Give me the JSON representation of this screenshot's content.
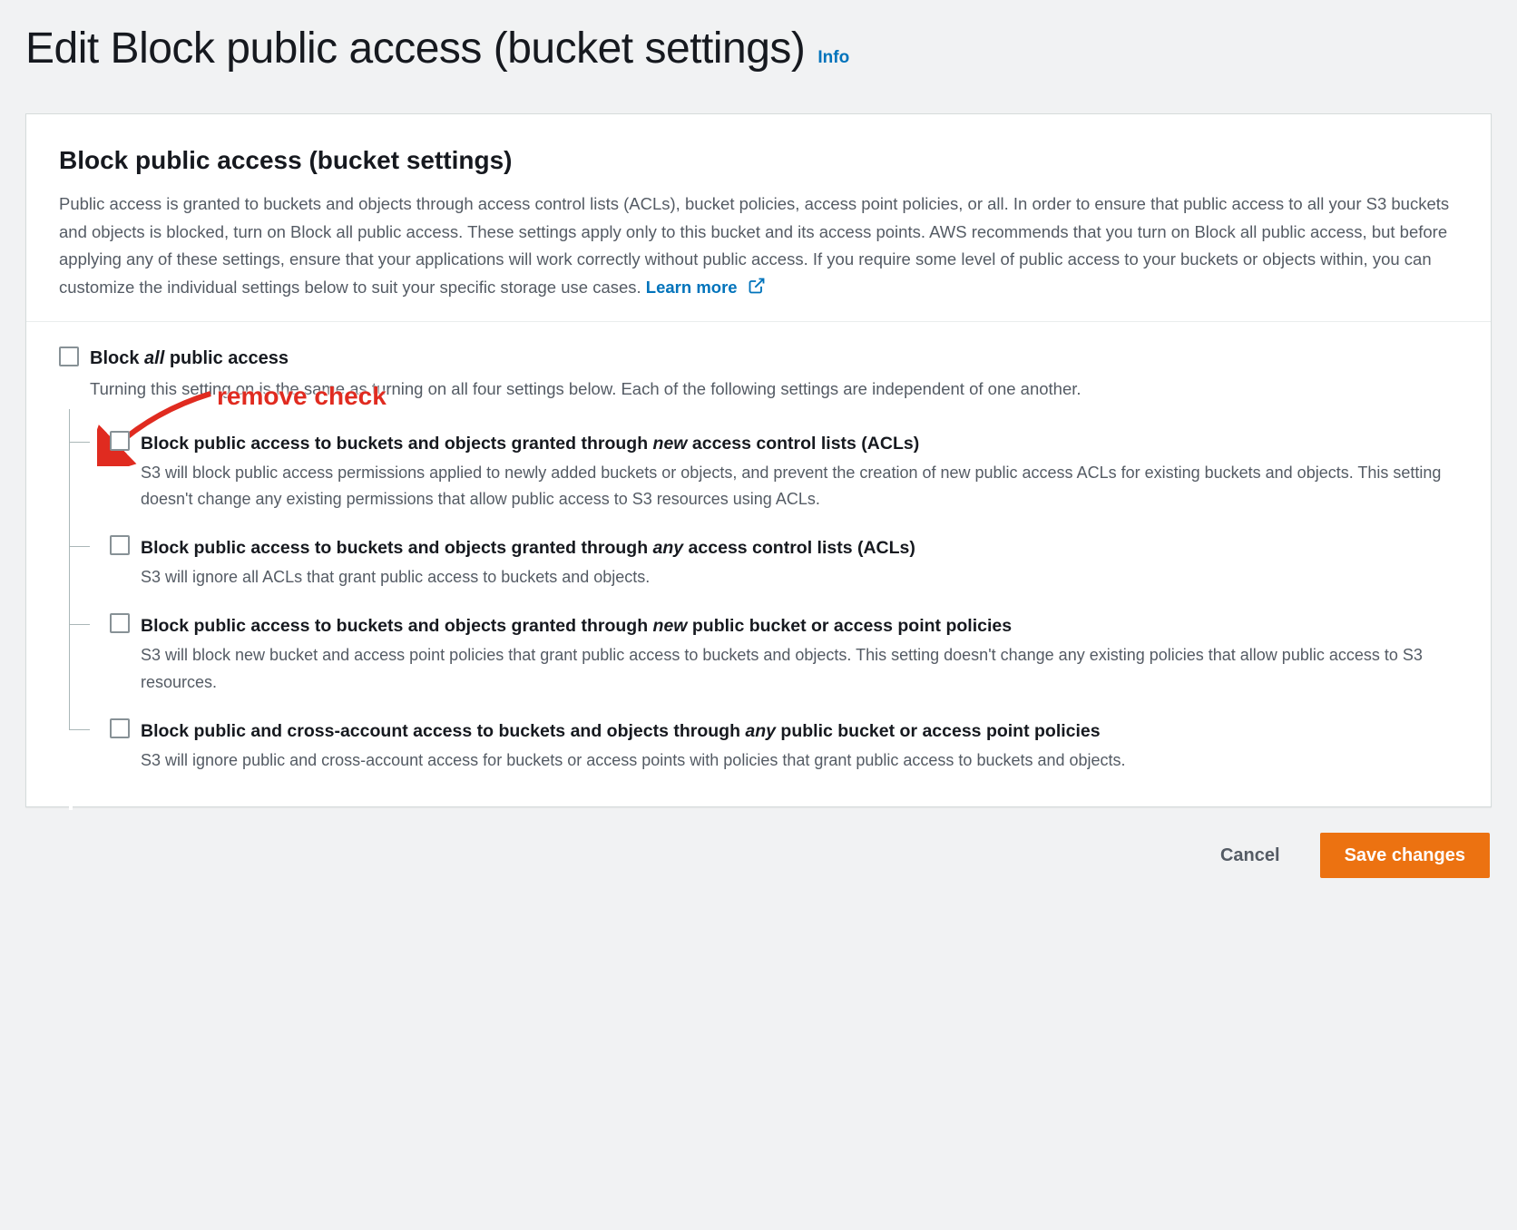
{
  "page": {
    "title": "Edit Block public access (bucket settings)",
    "info_label": "Info"
  },
  "panel": {
    "heading": "Block public access (bucket settings)",
    "description": "Public access is granted to buckets and objects through access control lists (ACLs), bucket policies, access point policies, or all. In order to ensure that public access to all your S3 buckets and objects is blocked, turn on Block all public access. These settings apply only to this bucket and its access points. AWS recommends that you turn on Block all public access, but before applying any of these settings, ensure that your applications will work correctly without public access. If you require some level of public access to your buckets or objects within, you can customize the individual settings below to suit your specific storage use cases.",
    "learn_more": "Learn more"
  },
  "block_all": {
    "label_pre": "Block ",
    "label_italic": "all",
    "label_post": " public access",
    "desc": "Turning this setting on is the same as turning on all four settings below. Each of the following settings are independent of one another."
  },
  "items": [
    {
      "label_pre": "Block public access to buckets and objects granted through ",
      "label_italic": "new",
      "label_post": " access control lists (ACLs)",
      "desc": "S3 will block public access permissions applied to newly added buckets or objects, and prevent the creation of new public access ACLs for existing buckets and objects. This setting doesn't change any existing permissions that allow public access to S3 resources using ACLs."
    },
    {
      "label_pre": "Block public access to buckets and objects granted through ",
      "label_italic": "any",
      "label_post": " access control lists (ACLs)",
      "desc": "S3 will ignore all ACLs that grant public access to buckets and objects."
    },
    {
      "label_pre": "Block public access to buckets and objects granted through ",
      "label_italic": "new",
      "label_post": " public bucket or access point policies",
      "desc": "S3 will block new bucket and access point policies that grant public access to buckets and objects. This setting doesn't change any existing policies that allow public access to S3 resources."
    },
    {
      "label_pre": "Block public and cross-account access to buckets and objects through ",
      "label_italic": "any",
      "label_post": " public bucket or access point policies",
      "desc": "S3 will ignore public and cross-account access for buckets or access points with policies that grant public access to buckets and objects."
    }
  ],
  "annotation": {
    "text": "remove check"
  },
  "buttons": {
    "cancel": "Cancel",
    "save": "Save changes"
  }
}
